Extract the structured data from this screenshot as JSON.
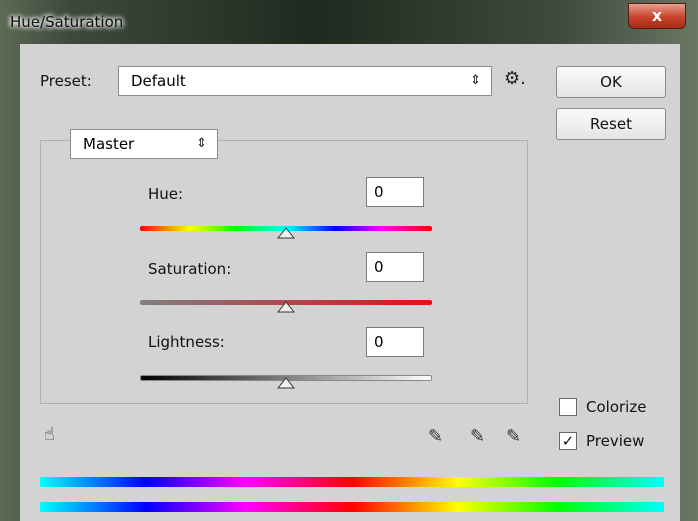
{
  "window": {
    "title": "Hue/Saturation",
    "close_label": "x"
  },
  "preset": {
    "label": "Preset:",
    "value": "Default",
    "updown": "⇕",
    "gear": "⚙."
  },
  "buttons": {
    "ok": "OK",
    "reset": "Reset"
  },
  "channel": {
    "value": "Master",
    "updown": "⇕"
  },
  "sliders": [
    {
      "label": "Hue:",
      "value": "0",
      "position": 0.5
    },
    {
      "label": "Saturation:",
      "value": "0",
      "position": 0.5
    },
    {
      "label": "Lightness:",
      "value": "0",
      "position": 0.5
    }
  ],
  "tools": {
    "hand": "☝",
    "eyedropper": "✎",
    "eyedropper_plus": "✎",
    "eyedropper_minus": "✎"
  },
  "options": {
    "colorize": {
      "label": "Colorize",
      "checked": false,
      "mark": ""
    },
    "preview": {
      "label": "Preview",
      "checked": true,
      "mark": "✓"
    }
  },
  "colors": {
    "dialog_bg": "#d3d3d3",
    "close": "#c8432b"
  }
}
